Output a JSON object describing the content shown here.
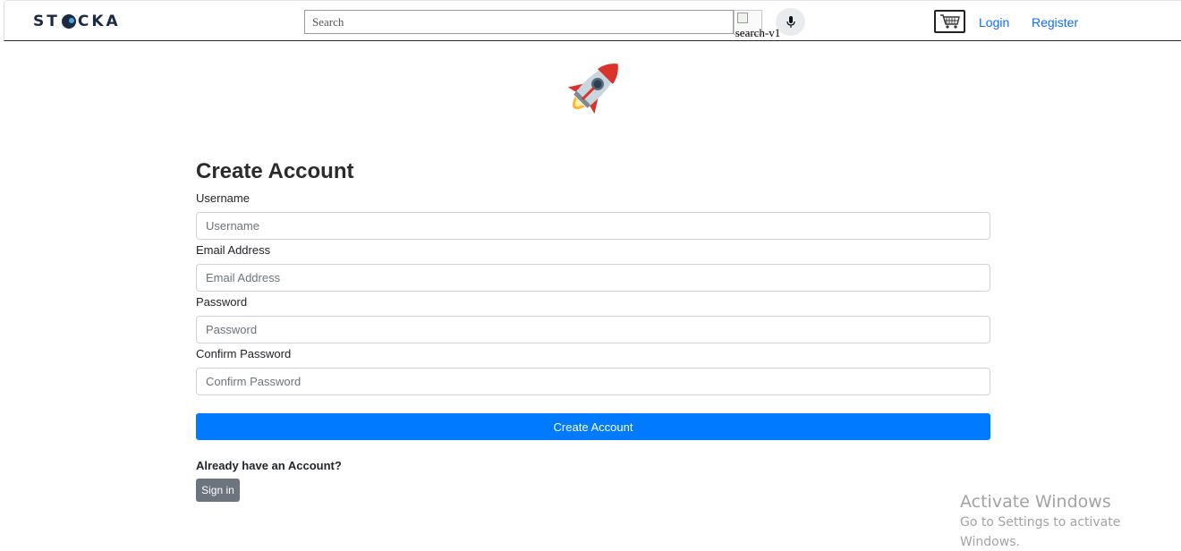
{
  "header": {
    "brand": "STOCKA",
    "search": {
      "placeholder": "Search",
      "value": ""
    },
    "search_image_alt": "search-v1",
    "mic_icon": "microphone-icon",
    "cart_icon": "cart-icon",
    "login_label": "Login",
    "register_label": "Register"
  },
  "hero": {
    "icon": "rocket-icon"
  },
  "form": {
    "title": "Create Account",
    "fields": [
      {
        "label": "Username",
        "placeholder": "Username",
        "value": ""
      },
      {
        "label": "Email Address",
        "placeholder": "Email Address",
        "value": ""
      },
      {
        "label": "Password",
        "placeholder": "Password",
        "value": ""
      },
      {
        "label": "Confirm Password",
        "placeholder": "Confirm Password",
        "value": ""
      }
    ],
    "submit_label": "Create Account",
    "already_text": "Already have an Account?",
    "signin_label": "Sign in"
  },
  "watermark": {
    "title": "Activate Windows",
    "subtitle": "Go to Settings to activate Windows."
  },
  "colors": {
    "primary": "#007bff",
    "secondary": "#6c757d",
    "link": "#0d6efd",
    "brand": "#1d2a44"
  }
}
